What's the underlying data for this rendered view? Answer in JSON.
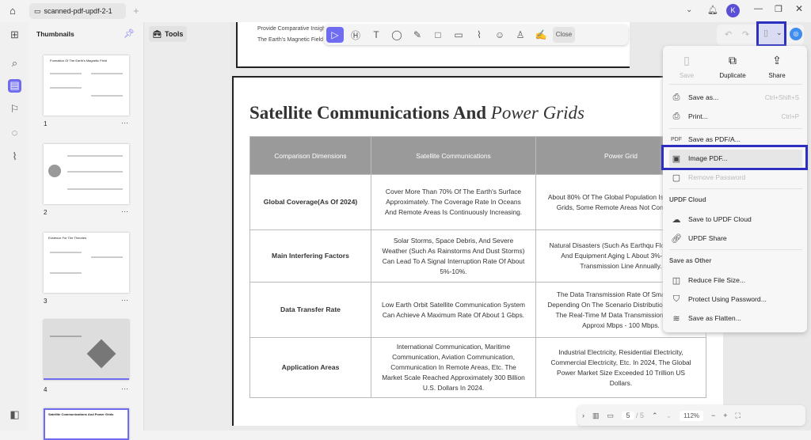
{
  "tab": {
    "title": "scanned-pdf-updf-2-1"
  },
  "avatar": "K",
  "thumbnails": {
    "title": "Thumbnails",
    "items": [
      {
        "num": "1"
      },
      {
        "num": "2"
      },
      {
        "num": "3"
      },
      {
        "num": "4"
      }
    ],
    "thumb_titles": [
      "Formation Of The Earth's Magnetic Field",
      "Evidence For The Theories",
      "Satellite Communications And Power Grids"
    ]
  },
  "tools_label": "Tools",
  "page1": {
    "line1": "Provide Comparative Insigh",
    "line2": "The Earth's Magnetic Field"
  },
  "toolbar": {
    "close": "Close"
  },
  "page": {
    "title_bold": "Satellite Communications And ",
    "title_italic": "Power Grids",
    "headers": [
      "Comparison Dimensions",
      "Satellite Communications",
      "Power Grid"
    ],
    "rows": [
      [
        "Global Coverage(As Of 2024)",
        "Cover More Than 70% Of The Earth's Surface Approximately. The Coverage Rate In Oceans And Remote Areas Is Continuously Increasing.",
        "About 80% Of The Global Population Is By Power Grids, Some Remote Areas Not Connected."
      ],
      [
        "Main Interfering Factors",
        "Solar Storms, Space Debris, And Severe Weather (Such As Rainstorms And Dust Storms) Can Lead To A Signal Interruption Rate Of About 5%-10%.",
        "Natural Disasters (Such As Earthqu Floods, Etc.) And Equipment Aging L About 3%-5% Of Transmission Line Annually."
      ],
      [
        "Data Transfer Rate",
        "Low Earth Orbit Satellite Communication System Can Achieve A Maximum Rate Of About 1 Gbps.",
        "The Data Transmission Rate Of Sma Varies Depending On The Scenario Distribution Network, The Real-Time M Data Transmission Rate Is Approxi Mbps - 100 Mbps."
      ],
      [
        "Application Areas",
        "International Communication, Maritime Communication, Aviation Communication, Communication In Remote Areas, Etc. The Market Scale Reached Approximately 300 Billion U.S. Dollars In 2024.",
        "Industrial Electricity, Residential Electricity, Commercial Electricity, Etc. In 2024, The Global Power Market Size Exceeded 10 Trillion US Dollars."
      ]
    ]
  },
  "menu": {
    "save": "Save",
    "duplicate": "Duplicate",
    "share": "Share",
    "save_as": "Save as...",
    "save_as_key": "Ctrl+Shift+S",
    "print": "Print...",
    "print_key": "Ctrl+P",
    "save_pdfa": "Save as PDF/A...",
    "image_pdf": "Image PDF...",
    "remove_password": "Remove Password",
    "cloud_section": "UPDF Cloud",
    "save_cloud": "Save to UPDF Cloud",
    "updf_share": "UPDF Share",
    "other_section": "Save as Other",
    "reduce": "Reduce File Size...",
    "protect": "Protect Using Password...",
    "flatten": "Save as Flatten..."
  },
  "bottombar": {
    "page": "5",
    "total": "/ 5",
    "zoom": "112%"
  },
  "colors": {
    "accent": "#6f6cf0",
    "highlight": "#2d2fbf"
  }
}
